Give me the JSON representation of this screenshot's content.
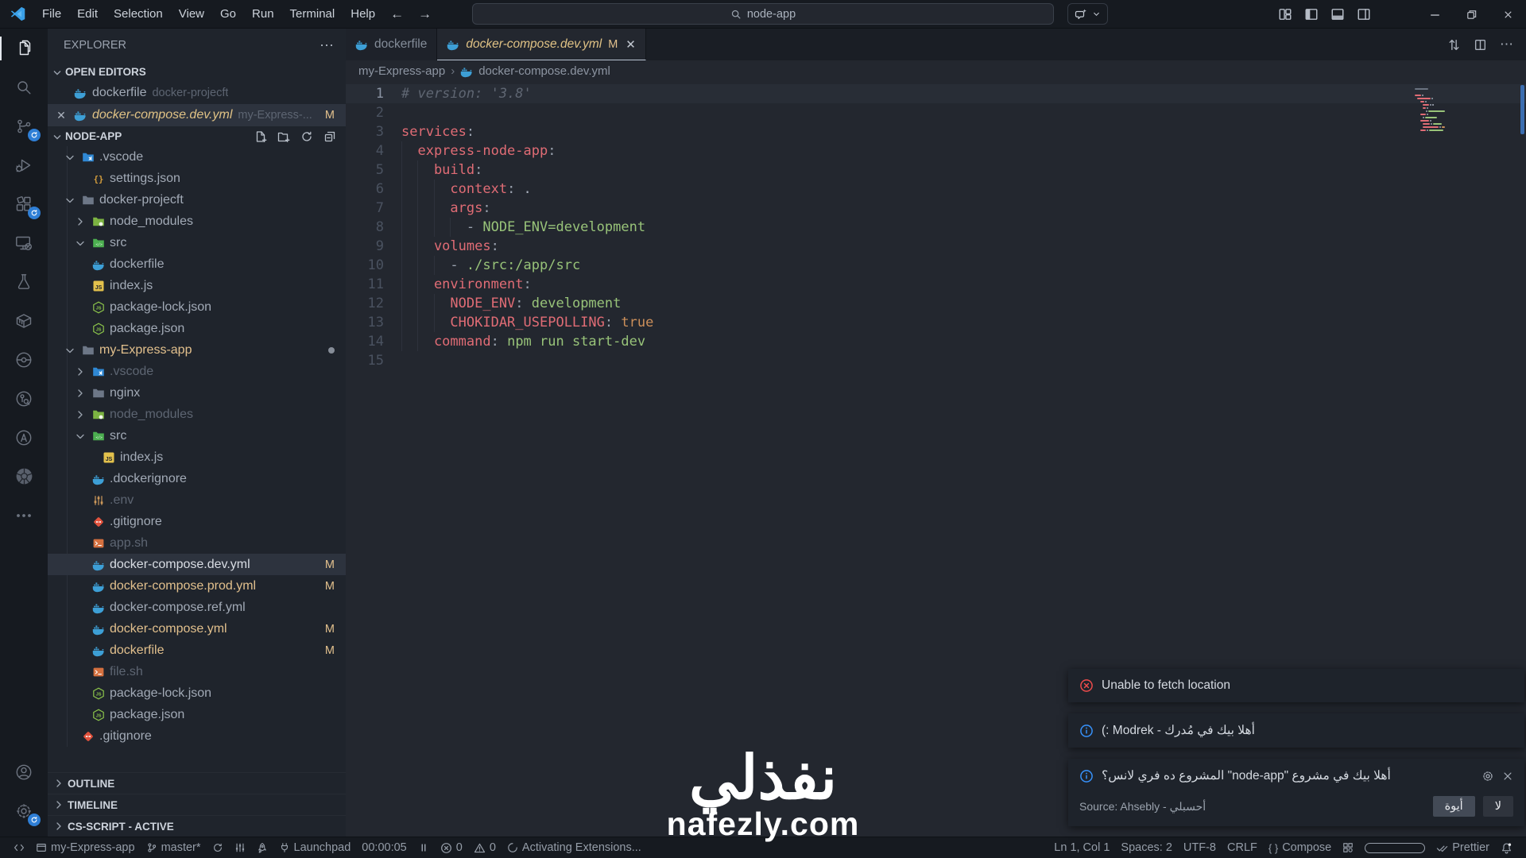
{
  "window": {
    "menus": [
      "File",
      "Edit",
      "Selection",
      "View",
      "Go",
      "Run",
      "Terminal",
      "Help"
    ],
    "search_value": "node-app"
  },
  "activity_bar": {
    "items": [
      {
        "name": "explorer",
        "active": true
      },
      {
        "name": "search"
      },
      {
        "name": "source-control",
        "badge": true
      },
      {
        "name": "run-debug"
      },
      {
        "name": "extensions",
        "badge": true
      },
      {
        "name": "remote-explorer"
      },
      {
        "name": "testing"
      },
      {
        "name": "containers"
      },
      {
        "name": "git-graph"
      },
      {
        "name": "git-history"
      },
      {
        "name": "ansible"
      },
      {
        "name": "kubernetes"
      },
      {
        "name": "more"
      }
    ],
    "bottom": [
      {
        "name": "accounts"
      },
      {
        "name": "settings",
        "badge": true
      }
    ]
  },
  "sidebar": {
    "title": "EXPLORER",
    "open_editors_label": "OPEN EDITORS",
    "open_editors": [
      {
        "label": "dockerfile",
        "desc": "docker-projecft",
        "icon": "docker"
      },
      {
        "label": "docker-compose.dev.yml",
        "desc": "my-Express-...",
        "icon": "docker",
        "badge": "M",
        "active": true,
        "close": true,
        "preview": true
      }
    ],
    "project_label": "NODE-APP",
    "header_actions": [
      "new-file",
      "new-folder",
      "refresh",
      "collapse-all"
    ],
    "tree": [
      {
        "label": ".vscode",
        "icon": "folder-vscode",
        "level": 1,
        "chev": "down"
      },
      {
        "label": "settings.json",
        "icon": "braces",
        "level": 2
      },
      {
        "label": "docker-projecft",
        "icon": "folder",
        "level": 1,
        "chev": "down"
      },
      {
        "label": "node_modules",
        "icon": "folder-node",
        "level": 2,
        "chev": "right"
      },
      {
        "label": "src",
        "icon": "folder-src",
        "level": 2,
        "chev": "down"
      },
      {
        "label": "dockerfile",
        "icon": "docker",
        "level": 2
      },
      {
        "label": "index.js",
        "icon": "js",
        "level": 2
      },
      {
        "label": "package-lock.json",
        "icon": "node",
        "level": 2
      },
      {
        "label": "package.json",
        "icon": "node",
        "level": 2
      },
      {
        "label": "my-Express-app",
        "icon": "folder",
        "level": 1,
        "chev": "down",
        "cls": "mod",
        "dot": true
      },
      {
        "label": ".vscode",
        "icon": "folder-vscode",
        "level": 2,
        "chev": "right",
        "cls": "dim"
      },
      {
        "label": "nginx",
        "icon": "folder",
        "level": 2,
        "chev": "right"
      },
      {
        "label": "node_modules",
        "icon": "folder-node",
        "level": 2,
        "chev": "right",
        "cls": "dim"
      },
      {
        "label": "src",
        "icon": "folder-src",
        "level": 2,
        "chev": "down"
      },
      {
        "label": "index.js",
        "icon": "js",
        "level": 3
      },
      {
        "label": ".dockerignore",
        "icon": "docker",
        "level": 2
      },
      {
        "label": ".env",
        "icon": "env",
        "level": 2,
        "cls": "dim"
      },
      {
        "label": ".gitignore",
        "icon": "git",
        "level": 2
      },
      {
        "label": "app.sh",
        "icon": "shell",
        "level": 2,
        "cls": "dim"
      },
      {
        "label": "docker-compose.dev.yml",
        "icon": "docker",
        "level": 2,
        "cls": "sel",
        "badge": "M"
      },
      {
        "label": "docker-compose.prod.yml",
        "icon": "docker",
        "level": 2,
        "cls": "mod",
        "badge": "M"
      },
      {
        "label": "docker-compose.ref.yml",
        "icon": "docker",
        "level": 2
      },
      {
        "label": "docker-compose.yml",
        "icon": "docker",
        "level": 2,
        "cls": "mod",
        "badge": "M"
      },
      {
        "label": "dockerfile",
        "icon": "docker",
        "level": 2,
        "cls": "mod",
        "badge": "M"
      },
      {
        "label": "file.sh",
        "icon": "shell",
        "level": 2,
        "cls": "dim"
      },
      {
        "label": "package-lock.json",
        "icon": "node",
        "level": 2
      },
      {
        "label": "package.json",
        "icon": "node",
        "level": 2
      },
      {
        "label": ".gitignore",
        "icon": "git",
        "level": 1
      }
    ],
    "sections": [
      "OUTLINE",
      "TIMELINE",
      "CS-SCRIPT - ACTIVE"
    ]
  },
  "editor": {
    "tabs": [
      {
        "label": "dockerfile",
        "active": false
      },
      {
        "label": "docker-compose.dev.yml",
        "active": true,
        "preview": true,
        "badge": "M",
        "close": true
      }
    ],
    "breadcrumb": {
      "folder": "my-Express-app",
      "file": "docker-compose.dev.yml"
    },
    "lines": [
      {
        "n": 1,
        "ind": 0,
        "cur": true,
        "t": [
          [
            "cm",
            "# version: '3.8'"
          ]
        ]
      },
      {
        "n": 2,
        "ind": 0,
        "t": []
      },
      {
        "n": 3,
        "ind": 0,
        "t": [
          [
            "k",
            "services"
          ],
          [
            "p",
            ":"
          ]
        ]
      },
      {
        "n": 4,
        "ind": 1,
        "t": [
          [
            "k",
            "express-node-app"
          ],
          [
            "p",
            ":"
          ]
        ]
      },
      {
        "n": 5,
        "ind": 2,
        "t": [
          [
            "k",
            "build"
          ],
          [
            "p",
            ":"
          ]
        ]
      },
      {
        "n": 6,
        "ind": 3,
        "t": [
          [
            "k",
            "context"
          ],
          [
            "p",
            ": "
          ],
          [
            "pl",
            "."
          ]
        ]
      },
      {
        "n": 7,
        "ind": 3,
        "t": [
          [
            "k",
            "args"
          ],
          [
            "p",
            ":"
          ]
        ]
      },
      {
        "n": 8,
        "ind": 4,
        "t": [
          [
            "p",
            "- "
          ],
          [
            "v",
            "NODE_ENV=development"
          ]
        ]
      },
      {
        "n": 9,
        "ind": 2,
        "t": [
          [
            "k",
            "volumes"
          ],
          [
            "p",
            ":"
          ]
        ]
      },
      {
        "n": 10,
        "ind": 3,
        "t": [
          [
            "p",
            "- "
          ],
          [
            "v",
            "./src:/app/src"
          ]
        ]
      },
      {
        "n": 11,
        "ind": 2,
        "t": [
          [
            "k",
            "environment"
          ],
          [
            "p",
            ":"
          ]
        ]
      },
      {
        "n": 12,
        "ind": 3,
        "t": [
          [
            "k",
            "NODE_ENV"
          ],
          [
            "p",
            ": "
          ],
          [
            "v",
            "development"
          ]
        ]
      },
      {
        "n": 13,
        "ind": 3,
        "t": [
          [
            "k",
            "CHOKIDAR_USEPOLLING"
          ],
          [
            "p",
            ": "
          ],
          [
            "o",
            "true"
          ]
        ]
      },
      {
        "n": 14,
        "ind": 2,
        "t": [
          [
            "k",
            "command"
          ],
          [
            "p",
            ": "
          ],
          [
            "v",
            "npm run start-dev"
          ]
        ]
      },
      {
        "n": 15,
        "ind": 0,
        "t": []
      }
    ]
  },
  "status_bar": {
    "left": [
      {
        "icon": "remote"
      },
      {
        "icon": "window",
        "label": "my-Express-app"
      },
      {
        "icon": "branch",
        "label": "master*"
      },
      {
        "icon": "sync"
      },
      {
        "icon": "tune"
      },
      {
        "icon": "rocket"
      },
      {
        "icon": "plug",
        "label": "Launchpad"
      },
      {
        "label": "00:00:05"
      },
      {
        "icon": "pause"
      },
      {
        "icon": "error",
        "label": "0"
      },
      {
        "icon": "warning",
        "label": "0"
      },
      {
        "icon": "spinner",
        "label": "Activating Extensions..."
      }
    ],
    "right": [
      {
        "label": "Ln 1, Col 1"
      },
      {
        "label": "Spaces: 2"
      },
      {
        "label": "UTF-8"
      },
      {
        "label": "CRLF"
      },
      {
        "icon": "braces",
        "label": "Compose"
      },
      {
        "icon": "ports"
      },
      {
        "icon": "pill"
      },
      {
        "icon": "dblcheck",
        "label": "Prettier"
      },
      {
        "icon": "bell"
      }
    ]
  },
  "notifications": [
    {
      "severity": "error",
      "message": "Unable to fetch location"
    },
    {
      "severity": "info",
      "message": "أهلا بيك في مُدرك - Modrek :)"
    },
    {
      "severity": "info",
      "message": "أهلا بيك في مشروع \"node-app\" المشروع ده فري لانس؟",
      "source": "Source: Ahsebly - أحسبلي",
      "buttons": [
        "أيوة",
        "لا"
      ],
      "actions": true
    }
  ],
  "watermark": {
    "arabic": "نفذلي",
    "domain": "nafezly.com"
  }
}
